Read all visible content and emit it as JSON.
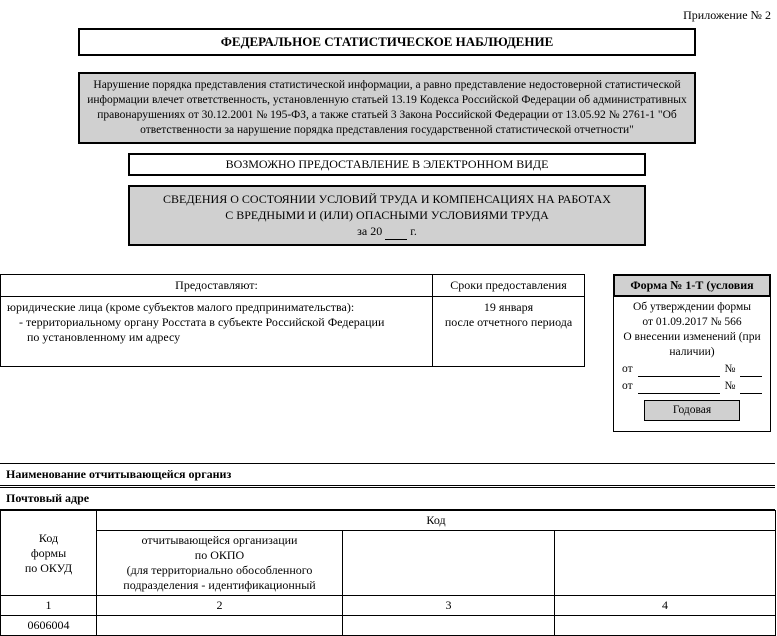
{
  "appendix": "Приложение № 2",
  "main_title": "ФЕДЕРАЛЬНОЕ СТАТИСТИЧЕСКОЕ НАБЛЮДЕНИЕ",
  "warning_text": "Нарушение порядка представления статистической информации, а равно представление недостоверной статистической информации влечет ответственность, установленную статьей 13.19 Кодекса Российской Федерации об административных правонарушениях от 30.12.2001 № 195-ФЗ, а также статьей 3 Закона Российской Федерации от 13.05.92 № 2761-1 \"Об ответственности за нарушение порядка представления государственной статистической отчетности\"",
  "electronic": "ВОЗМОЖНО ПРЕДОСТАВЛЕНИЕ В ЭЛЕКТРОННОМ ВИДЕ",
  "info_box": {
    "line1": "СВЕДЕНИЯ О СОСТОЯНИИ УСЛОВИЙ ТРУДА И КОМПЕНСАЦИЯХ НА РАБОТАХ",
    "line2": "С ВРЕДНЫМИ И (ИЛИ) ОПАСНЫМИ УСЛОВИЯМИ ТРУДА",
    "year_prefix": "за 20",
    "year_suffix": "г."
  },
  "present": {
    "header_left": "Предоставляют:",
    "header_right": "Сроки предоставления",
    "body_left_l1": "юридические лица (кроме субъектов малого предпринимательства):",
    "body_left_l2": "- территориальному органу Росстата в субъекте Российской Федерации",
    "body_left_l3": "по установленному им адресу",
    "body_right_l1": "19 января",
    "body_right_l2": "после отчетного периода"
  },
  "form_box": {
    "header": "Форма № 1-Т (условия",
    "line1": "Об утверждении формы",
    "line2": "от 01.09.2017 № 566",
    "line3": "О внесении изменений (при наличии)",
    "ot": "от",
    "num": "№",
    "annual": "Годовая"
  },
  "rows": {
    "name_label": "Наименование отчитывающейся организ",
    "addr_label": "Почтовый адре"
  },
  "code_table": {
    "col1_l1": "Код",
    "col1_l2": "формы",
    "col1_l3": "по ОКУД",
    "code_header": "Код",
    "col2_l1": "отчитывающейся организации",
    "col2_l2": "по ОКПО",
    "col2_l3": "(для территориально обособленного",
    "col2_l4": "подразделения - идентификационный",
    "n1": "1",
    "n2": "2",
    "n3": "3",
    "n4": "4",
    "okud": "0606004"
  }
}
